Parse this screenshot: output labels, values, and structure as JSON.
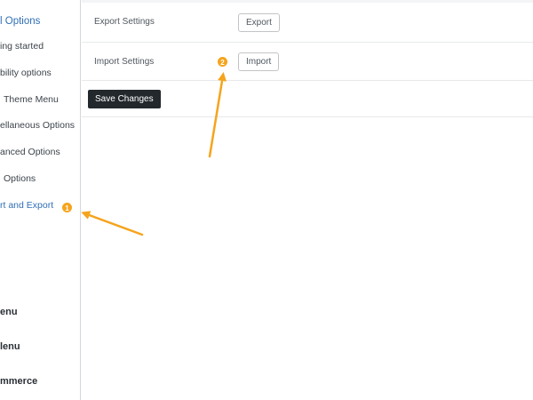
{
  "sidebar": {
    "items": [
      {
        "label": "l Options"
      },
      {
        "label": "ing started"
      },
      {
        "label": "bility options"
      },
      {
        "label": "Theme Menu"
      },
      {
        "label": "ellaneous Options"
      },
      {
        "label": "anced Options"
      },
      {
        "label": "Options"
      },
      {
        "label": "rt and Export"
      },
      {
        "label": "enu"
      },
      {
        "label": "lenu"
      },
      {
        "label": "mmerce"
      }
    ]
  },
  "settings": {
    "export_label": "Export Settings",
    "export_button": "Export",
    "import_label": "Import Settings",
    "import_button": "Import",
    "save_button": "Save Changes"
  },
  "annotations": {
    "badge_1": "1",
    "badge_2": "2",
    "color": "#f5a41d"
  }
}
